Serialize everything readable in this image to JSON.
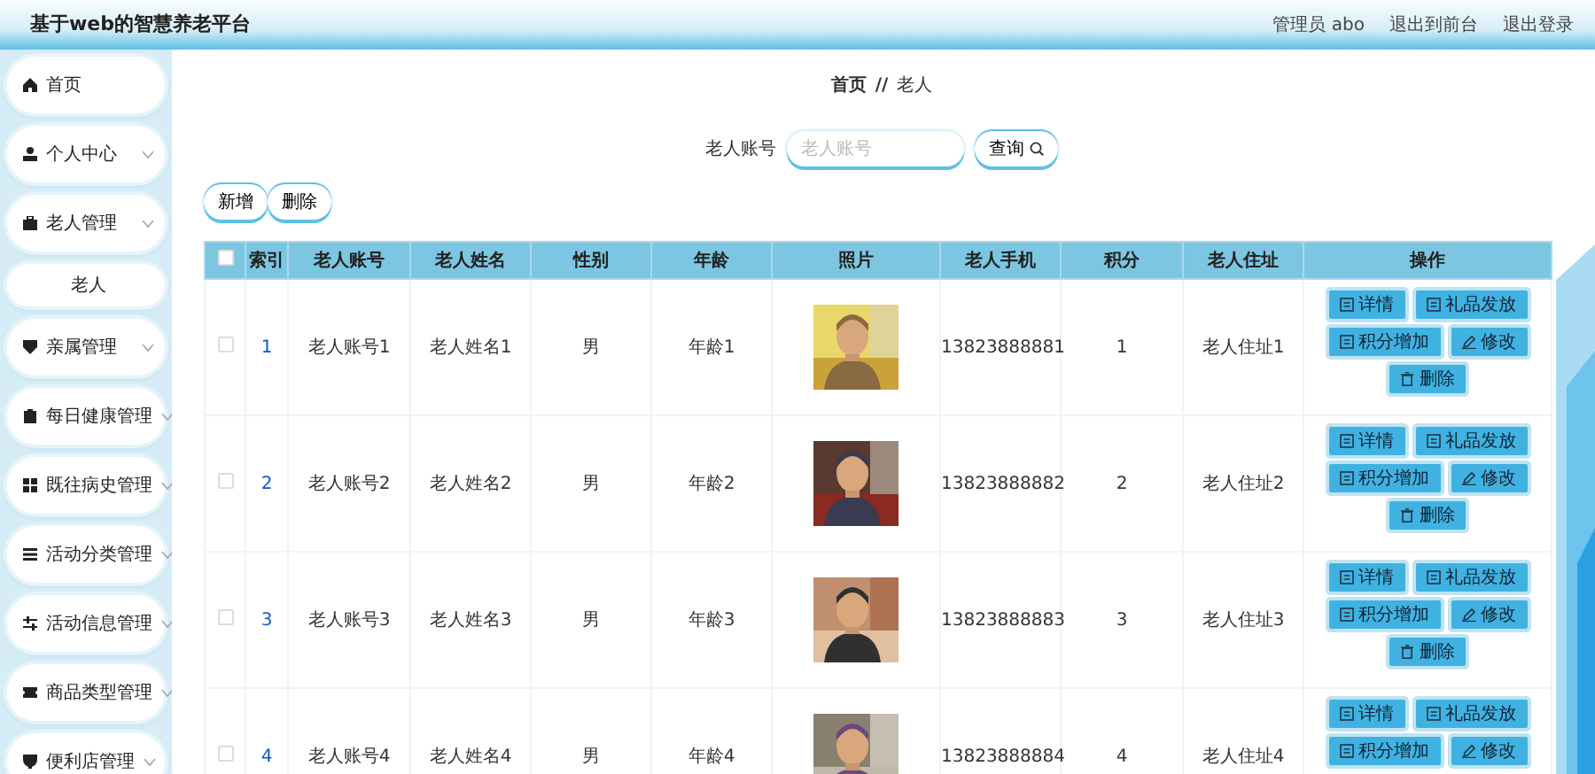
{
  "header": {
    "title": "基于web的智慧养老平台",
    "links": [
      "管理员 abo",
      "退出到前台",
      "退出登录"
    ]
  },
  "sidebar": {
    "items": [
      {
        "label": "首页",
        "kind": "link"
      },
      {
        "label": "个人中心",
        "kind": "menu"
      },
      {
        "label": "老人管理",
        "kind": "menu"
      },
      {
        "label": "老人",
        "kind": "sub"
      },
      {
        "label": "亲属管理",
        "kind": "menu"
      },
      {
        "label": "每日健康管理",
        "kind": "menu"
      },
      {
        "label": "既往病史管理",
        "kind": "menu"
      },
      {
        "label": "活动分类管理",
        "kind": "menu"
      },
      {
        "label": "活动信息管理",
        "kind": "menu"
      },
      {
        "label": "商品类型管理",
        "kind": "menu"
      },
      {
        "label": "便利店管理",
        "kind": "menu"
      }
    ]
  },
  "breadcrumb": [
    "首页",
    "//",
    "老人"
  ],
  "search": {
    "label": "老人账号",
    "placeholder": "老人账号",
    "button": "查询"
  },
  "toolbar": [
    "新增",
    "删除"
  ],
  "table": {
    "select_all_checked": false,
    "columns": [
      "索引",
      "老人账号",
      "老人姓名",
      "性别",
      "年龄",
      "照片",
      "老人手机",
      "积分",
      "老人住址",
      "操作"
    ],
    "rows": [
      {
        "checked": false,
        "cells": [
          "1",
          "老人账号1",
          "老人姓名1",
          "男",
          "年龄1"
        ],
        "photo": {
          "kind": "picture"
        },
        "phone": "13823888881",
        "points": "1",
        "address": "老人住址1",
        "actions": [
          {
            "label": "详情",
            "kind": "detail"
          },
          {
            "label": "礼品发放",
            "kind": "detail"
          },
          {
            "label": "积分增加",
            "kind": "detail"
          },
          {
            "label": "修改",
            "kind": "edit"
          },
          {
            "label": "删除",
            "kind": "delete"
          }
        ]
      },
      {
        "checked": false,
        "cells": [
          "2",
          "老人账号2",
          "老人姓名2",
          "男",
          "年龄2"
        ],
        "photo": {
          "kind": "picture"
        },
        "phone": "13823888882",
        "points": "2",
        "address": "老人住址2",
        "actions": [
          {
            "label": "详情",
            "kind": "detail"
          },
          {
            "label": "礼品发放",
            "kind": "detail"
          },
          {
            "label": "积分增加",
            "kind": "detail"
          },
          {
            "label": "修改",
            "kind": "edit"
          },
          {
            "label": "删除",
            "kind": "delete"
          }
        ]
      },
      {
        "checked": false,
        "cells": [
          "3",
          "老人账号3",
          "老人姓名3",
          "男",
          "年龄3"
        ],
        "photo": {
          "kind": "picture"
        },
        "phone": "13823888883",
        "points": "3",
        "address": "老人住址3",
        "actions": [
          {
            "label": "详情",
            "kind": "detail"
          },
          {
            "label": "礼品发放",
            "kind": "detail"
          },
          {
            "label": "积分增加",
            "kind": "detail"
          },
          {
            "label": "修改",
            "kind": "edit"
          },
          {
            "label": "删除",
            "kind": "delete"
          }
        ]
      },
      {
        "checked": false,
        "cells": [
          "4",
          "老人账号4",
          "老人姓名4",
          "男",
          "年龄4"
        ],
        "photo": {
          "kind": "picture"
        },
        "phone": "13823888884",
        "points": "4",
        "address": "老人住址4",
        "actions": [
          {
            "label": "详情",
            "kind": "detail"
          },
          {
            "label": "礼品发放",
            "kind": "detail"
          },
          {
            "label": "积分增加",
            "kind": "detail"
          },
          {
            "label": "修改",
            "kind": "edit"
          }
        ]
      }
    ]
  }
}
